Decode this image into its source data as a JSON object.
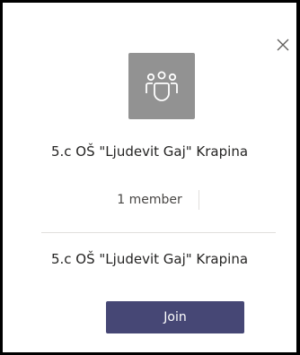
{
  "dialog": {
    "team_name": "5.c OŠ \"Ljudevit Gaj\" Krapina",
    "description": "5.c OŠ \"Ljudevit Gaj\" Krapina",
    "member_count": "1 member",
    "join_label": "Join",
    "close_icon": "close-icon",
    "team_icon": "team-people-icon"
  },
  "colors": {
    "avatar_bg": "#929292",
    "join_bg": "#464775",
    "join_text": "#ffffff",
    "border": "#000000"
  }
}
